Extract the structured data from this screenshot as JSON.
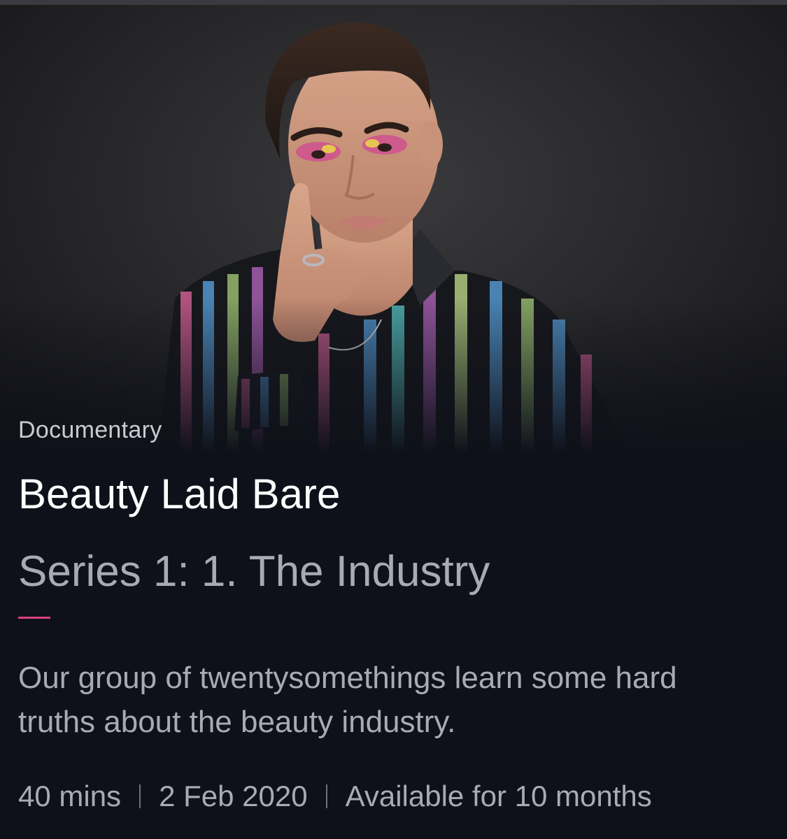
{
  "hero": {
    "image_subject": "portrait of a person wearing eye makeup and a striped multicolor shirt",
    "icon": "hero-portrait-image"
  },
  "programme": {
    "genre": "Documentary",
    "title": "Beauty Laid Bare",
    "episode": "Series 1: 1. The Industry",
    "description": "Our group of twentysomethings learn some hard truths about the beauty industry.",
    "duration": "40 mins",
    "broadcast_date": "2 Feb 2020",
    "availability": "Available for 10 months"
  },
  "colors": {
    "background": "#0f111a",
    "accent": "#d6407f",
    "title": "#ffffff",
    "secondary_text": "#a9abb3"
  }
}
